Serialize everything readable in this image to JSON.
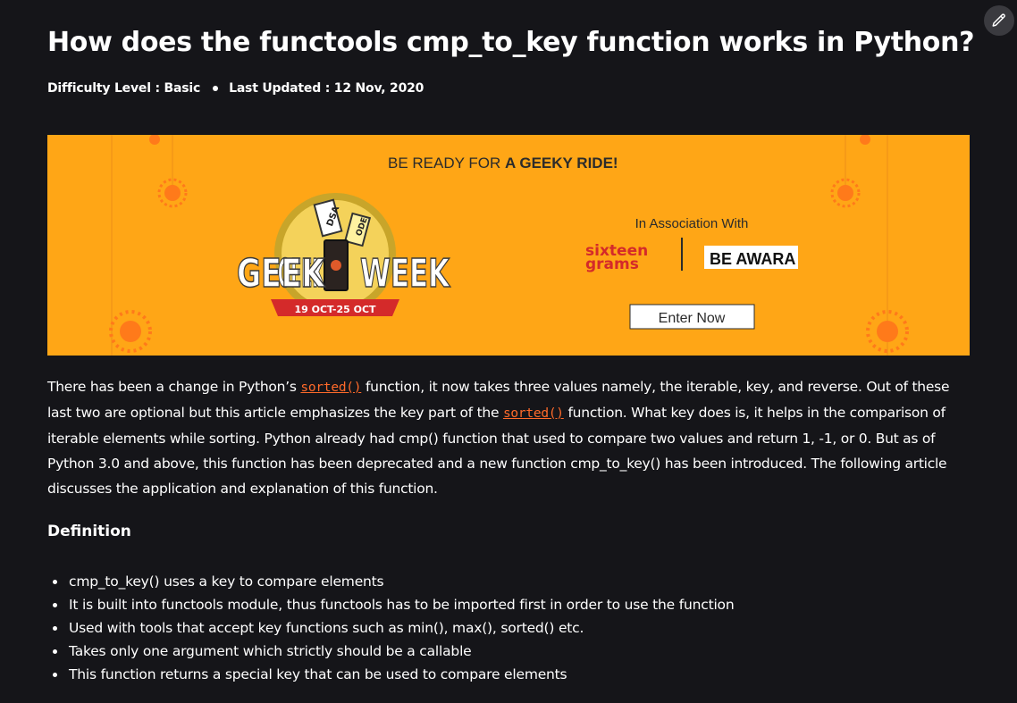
{
  "article": {
    "title": "How does the functools cmp_to_key function works in Python?",
    "difficulty": "Difficulty Level : Basic",
    "last_updated": "Last Updated : 12 Nov, 2020"
  },
  "banner": {
    "tagline_pre": "BE READY FOR ",
    "tagline_bold": "A GEEKY RIDE!",
    "logo_left": "GEEK",
    "logo_right": "WEEK",
    "dates": "19 OCT-25 OCT",
    "ticket1": "DSA",
    "ticket2": "ODE",
    "association": "In Association With",
    "partner1_line1": "sixteen",
    "partner1_line2": "grams",
    "partner2": "BE AWARA",
    "cta": "Enter Now",
    "colors": {
      "background": "#ffa616",
      "accent_red": "#d42a2a",
      "dark": "#2b2b2b"
    }
  },
  "body": {
    "p1_a": "There has been a change in Python’s ",
    "link1": "sorted()",
    "p1_b": " function, it now takes three values namely, the iterable, key, and reverse. Out of these last two are optional but this article emphasizes the key part of the ",
    "link2": "sorted()",
    "p1_c": " function. What key does is, it helps in the comparison of iterable elements while sorting.  Python already had cmp() function that used to compare two values and return 1, -1, or 0. But as of Python 3.0 and above, this function has been deprecated and a new function cmp_to_key() has been introduced. The following article discusses the application and explanation of this function.",
    "definition_heading": "Definition",
    "bullets": [
      "cmp_to_key() uses a key to compare elements",
      "It is built into functools module, thus functools has to be imported first in order to use the function",
      "Used with tools that accept key functions such as min(), max(), sorted() etc.",
      "Takes only one argument which strictly should be a callable",
      "This function returns a special key that can be used to compare elements"
    ]
  },
  "icons": {
    "edit": "pencil-icon"
  },
  "colors": {
    "page_bg": "#151519",
    "text": "#ffffff",
    "link": "#ff6a2a"
  }
}
